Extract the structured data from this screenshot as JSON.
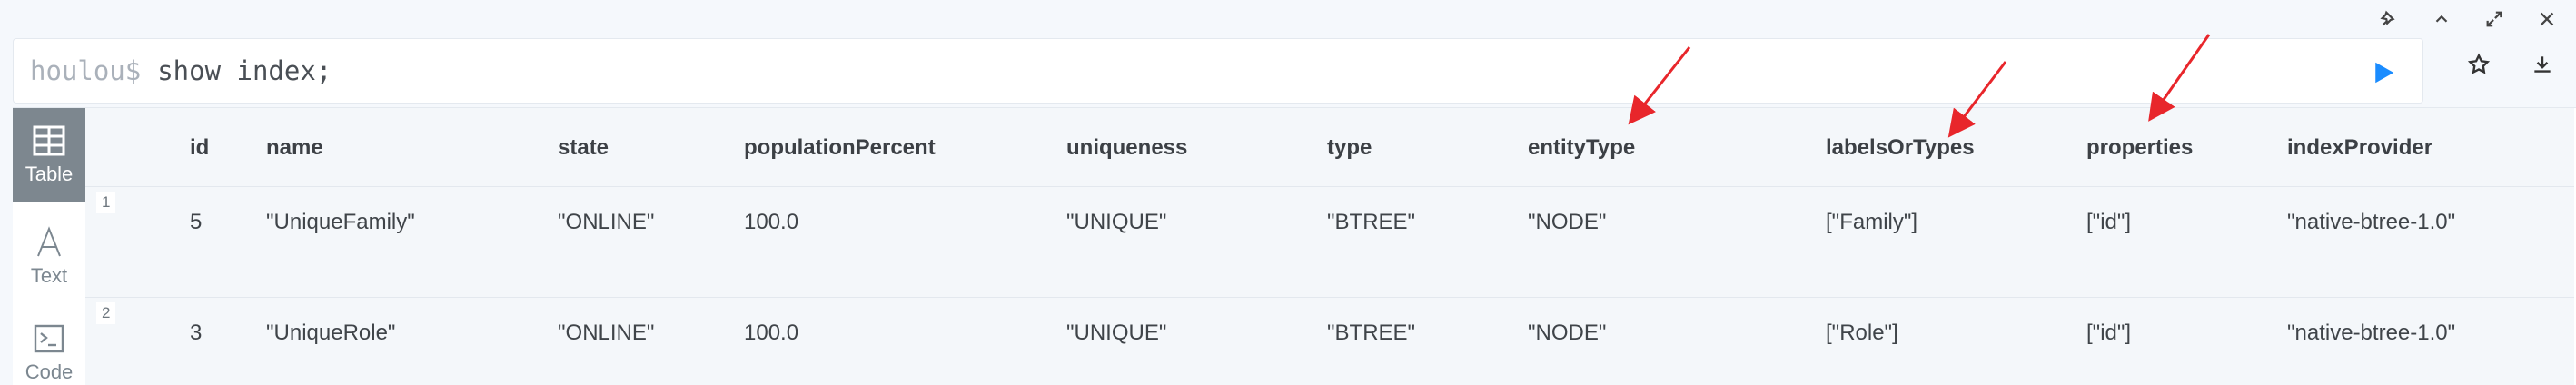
{
  "window_controls": [
    "pin-icon",
    "collapse-icon",
    "expand-icon",
    "close-icon"
  ],
  "command": {
    "prompt": "houlou$",
    "text": "show index;"
  },
  "actions": [
    "star-icon",
    "download-icon",
    "run-icon"
  ],
  "view_tabs": [
    {
      "label": "Table",
      "icon": "table-icon",
      "active": true
    },
    {
      "label": "Text",
      "icon": "text-icon",
      "active": false
    },
    {
      "label": "Code",
      "icon": "code-icon",
      "active": false
    }
  ],
  "table": {
    "columns": [
      "id",
      "name",
      "state",
      "populationPercent",
      "uniqueness",
      "type",
      "entityType",
      "labelsOrTypes",
      "properties",
      "indexProvider"
    ],
    "rows": [
      {
        "num": "1",
        "cells": [
          "5",
          "\"UniqueFamily\"",
          "\"ONLINE\"",
          "100.0",
          "\"UNIQUE\"",
          "\"BTREE\"",
          "\"NODE\"",
          "[\"Family\"]",
          "[\"id\"]",
          "\"native-btree-1.0\""
        ]
      },
      {
        "num": "2",
        "cells": [
          "3",
          "\"UniqueRole\"",
          "\"ONLINE\"",
          "100.0",
          "\"UNIQUE\"",
          "\"BTREE\"",
          "\"NODE\"",
          "[\"Role\"]",
          "[\"id\"]",
          "\"native-btree-1.0\""
        ]
      }
    ]
  },
  "colors": {
    "run_button": "#1a8cff",
    "annotation_arrow": "#e8262b",
    "active_tab": "#7d878f"
  }
}
